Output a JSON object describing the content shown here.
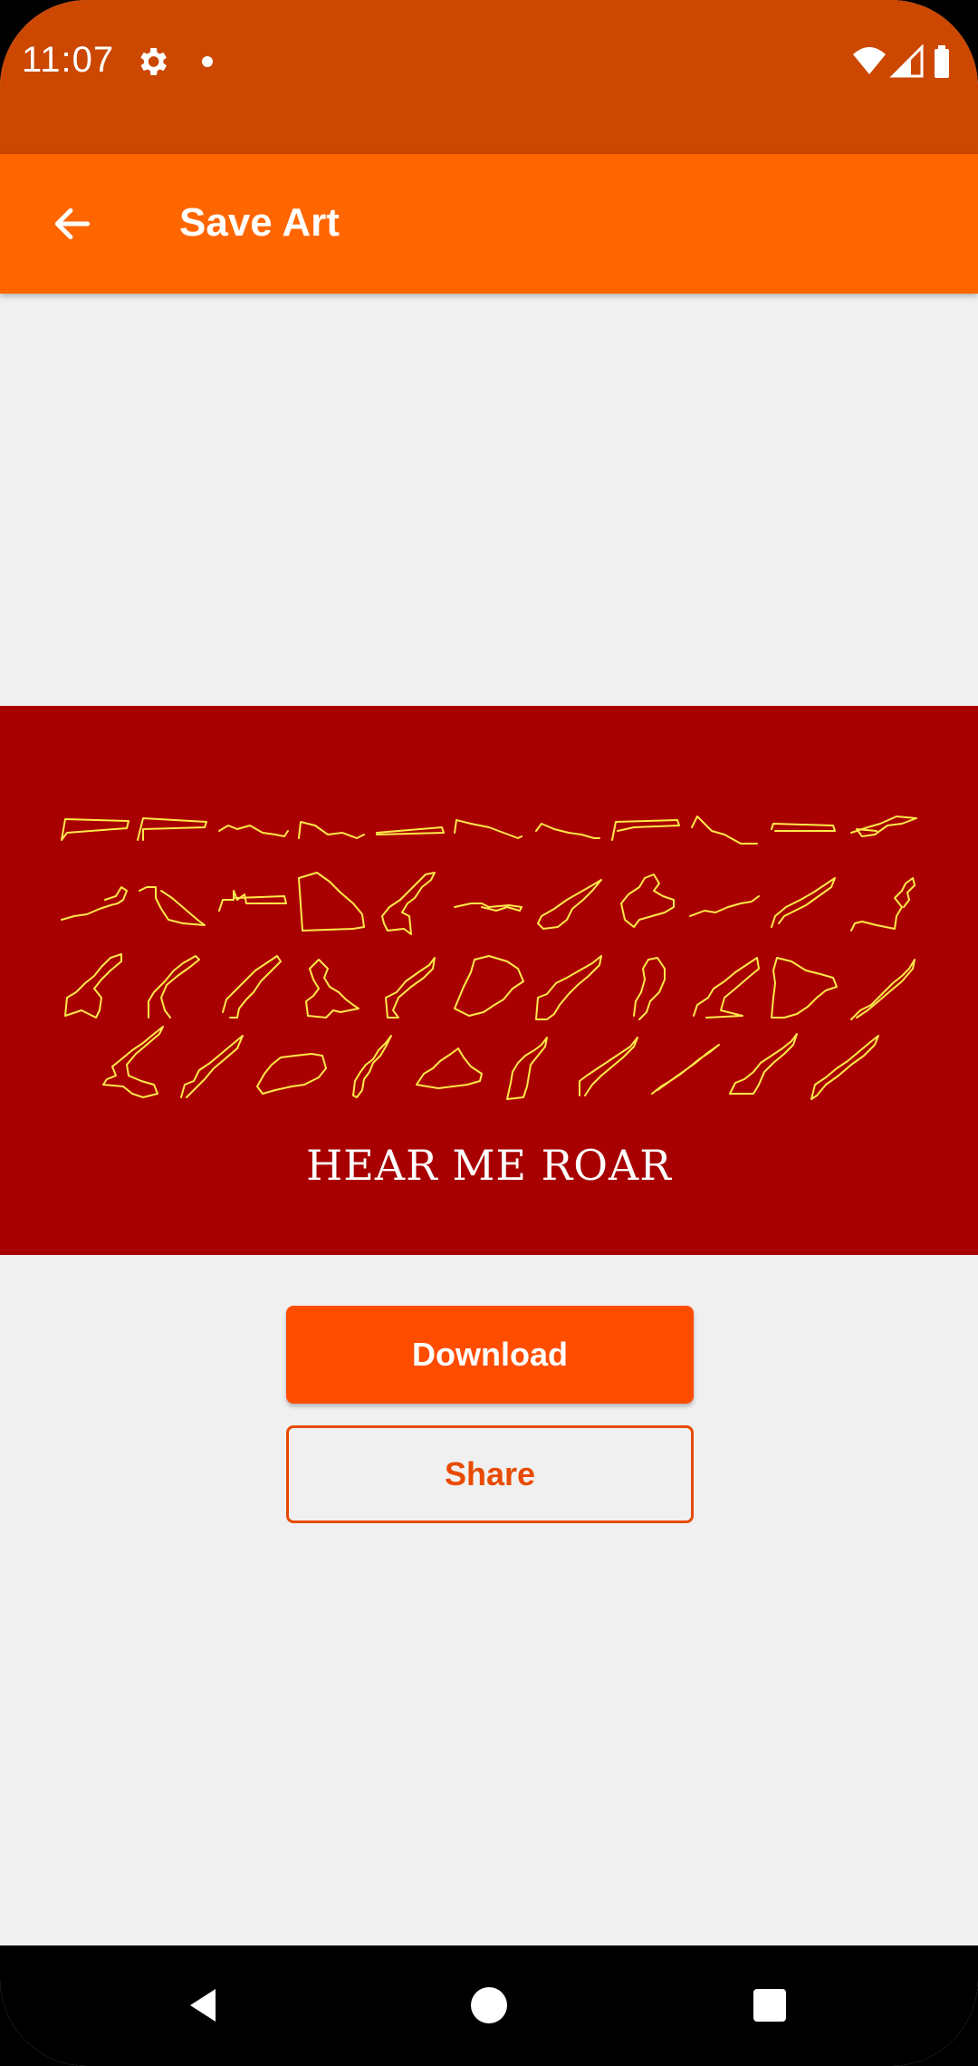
{
  "status_bar": {
    "time": "11:07",
    "icons": [
      "gear-icon",
      "notification-dot-icon",
      "wifi-icon",
      "cellular-signal-icon",
      "battery-icon"
    ]
  },
  "app_bar": {
    "title": "Save Art",
    "back_icon": "arrow-back-icon"
  },
  "art": {
    "caption": "HEAR ME ROAR",
    "background_color": "#a80000",
    "route_color": "#ffe94a"
  },
  "actions": {
    "download_label": "Download",
    "share_label": "Share"
  },
  "colors": {
    "status_bar": "#cc4700",
    "app_bar": "#ff6600",
    "primary_button": "#ff4d00",
    "outline_button": "#e84b00"
  },
  "nav_bar": {
    "icons": [
      "nav-back-icon",
      "nav-home-icon",
      "nav-recents-icon"
    ]
  }
}
